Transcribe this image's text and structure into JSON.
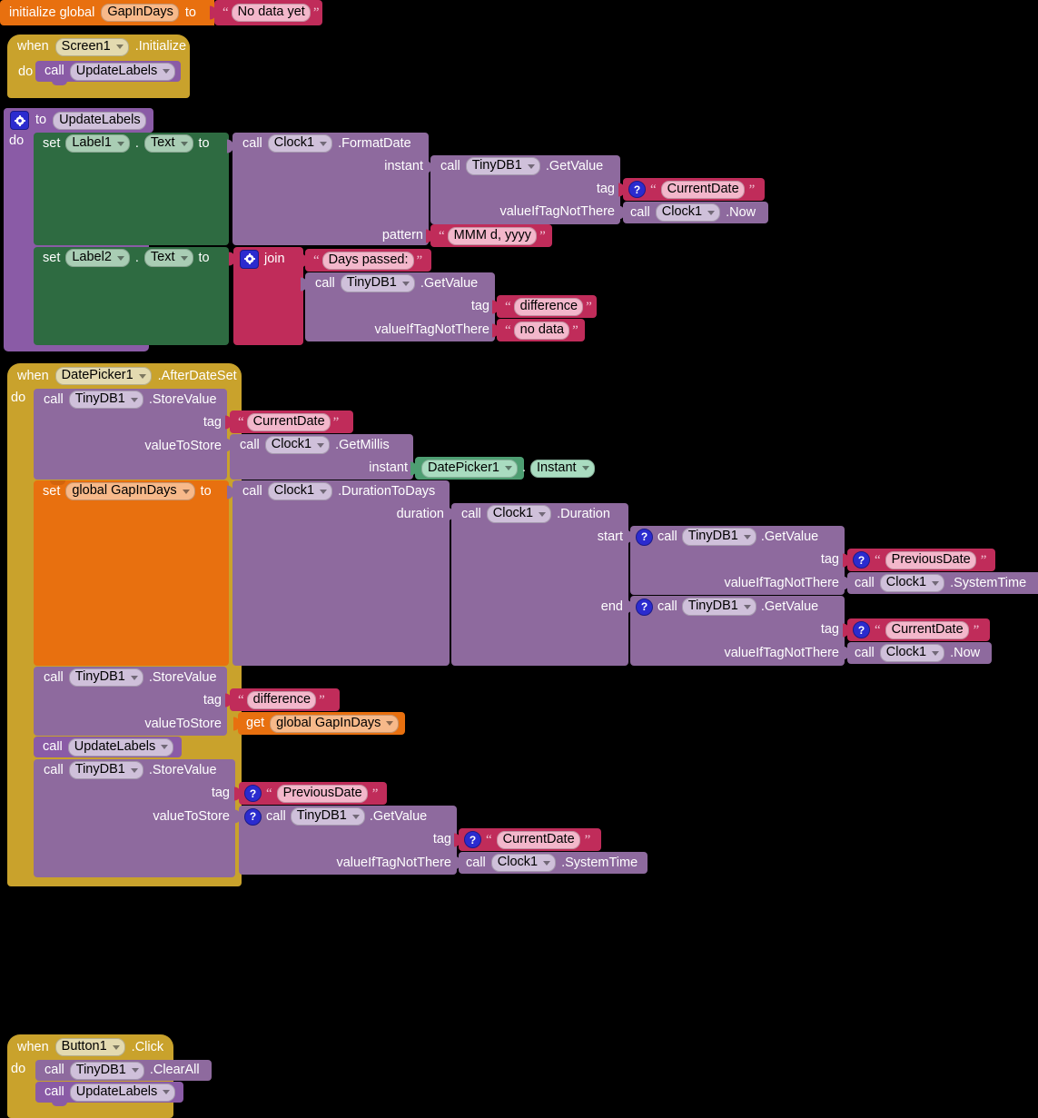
{
  "workspace": {
    "app": "MIT App Inventor Blocks Editor",
    "background": "#000000"
  },
  "colors": {
    "variable": "#e8700f",
    "event": "#c9a22c",
    "procedure": "#8a5ba6",
    "component": "#8e6a9e",
    "component_getter": "#4e9e72",
    "text": "#c02c5a",
    "setter": "#2e6b41",
    "badge": "#2b2bcf"
  },
  "blocks": {
    "global_init": {
      "keyword": "initialize global",
      "name": "GapInDays",
      "to": "to",
      "value": "No data yet"
    },
    "screen_init": {
      "when": "when",
      "component": "Screen1",
      "event": ".Initialize",
      "do": "do",
      "call": "call",
      "procedure": "UpdateLabels"
    },
    "update_labels_proc": {
      "to": "to",
      "name": "UpdateLabels",
      "do": "do",
      "gear_icon": "gear-icon",
      "set1": {
        "set": "set",
        "component": "Label1",
        "dot": ".",
        "property": "Text",
        "to": "to",
        "call": "call",
        "clock": "Clock1",
        "method": ".FormatDate",
        "arg_instant": "instant",
        "instant_call": "call",
        "instant_component": "TinyDB1",
        "instant_method": ".GetValue",
        "tag_label": "tag",
        "tag_value": "CurrentDate",
        "vtnt_label": "valueIfTagNotThere",
        "vtnt_call": "call",
        "vtnt_component": "Clock1",
        "vtnt_method": ".Now",
        "pattern_label": "pattern",
        "pattern_value": "MMM d, yyyy"
      },
      "set2": {
        "set": "set",
        "component": "Label2",
        "dot": ".",
        "property": "Text",
        "to": "to",
        "join": "join",
        "join_text": "Days passed:",
        "call": "call",
        "component_db": "TinyDB1",
        "method": ".GetValue",
        "tag_label": "tag",
        "tag_value": "difference",
        "vtnt_label": "valueIfTagNotThere",
        "vtnt_value": "no data"
      }
    },
    "datepicker_event": {
      "when": "when",
      "component": "DatePicker1",
      "event": ".AfterDateSet",
      "do": "do",
      "store_current": {
        "call": "call",
        "component": "TinyDB1",
        "method": ".StoreValue",
        "tag_label": "tag",
        "tag_value": "CurrentDate",
        "vts_label": "valueToStore",
        "vts_call": "call",
        "vts_component": "Clock1",
        "vts_method": ".GetMillis",
        "instant_label": "instant",
        "instant_component": "DatePicker1",
        "instant_dot": ".",
        "instant_property": "Instant"
      },
      "set_gap": {
        "set": "set",
        "variable": "global GapInDays",
        "to": "to",
        "call": "call",
        "component": "Clock1",
        "method": ".DurationToDays",
        "duration_label": "duration",
        "duration_call": "call",
        "duration_component": "Clock1",
        "duration_method": ".Duration",
        "start_label": "start",
        "start_call": "call",
        "start_component": "TinyDB1",
        "start_method": ".GetValue",
        "start_tag_label": "tag",
        "start_tag_value": "PreviousDate",
        "start_vtnt_label": "valueIfTagNotThere",
        "start_vtnt_call": "call",
        "start_vtnt_component": "Clock1",
        "start_vtnt_method": ".SystemTime",
        "end_label": "end",
        "end_call": "call",
        "end_component": "TinyDB1",
        "end_method": ".GetValue",
        "end_tag_label": "tag",
        "end_tag_value": "CurrentDate",
        "end_vtnt_label": "valueIfTagNotThere",
        "end_vtnt_call": "call",
        "end_vtnt_component": "Clock1",
        "end_vtnt_method": ".Now"
      },
      "store_difference": {
        "call": "call",
        "component": "TinyDB1",
        "method": ".StoreValue",
        "tag_label": "tag",
        "tag_value": "difference",
        "vts_label": "valueToStore",
        "get": "get",
        "get_variable": "global GapInDays"
      },
      "call_update": {
        "call": "call",
        "procedure": "UpdateLabels"
      },
      "store_previous": {
        "call": "call",
        "component": "TinyDB1",
        "method": ".StoreValue",
        "tag_label": "tag",
        "tag_value": "PreviousDate",
        "vts_label": "valueToStore",
        "vts_call": "call",
        "vts_component": "TinyDB1",
        "vts_method": ".GetValue",
        "inner_tag_label": "tag",
        "inner_tag_value": "CurrentDate",
        "inner_vtnt_label": "valueIfTagNotThere",
        "inner_vtnt_call": "call",
        "inner_vtnt_component": "Clock1",
        "inner_vtnt_method": ".SystemTime"
      }
    },
    "button_event": {
      "when": "when",
      "component": "Button1",
      "event": ".Click",
      "do": "do",
      "clear": {
        "call": "call",
        "component": "TinyDB1",
        "method": ".ClearAll"
      },
      "update": {
        "call": "call",
        "procedure": "UpdateLabels"
      }
    }
  }
}
